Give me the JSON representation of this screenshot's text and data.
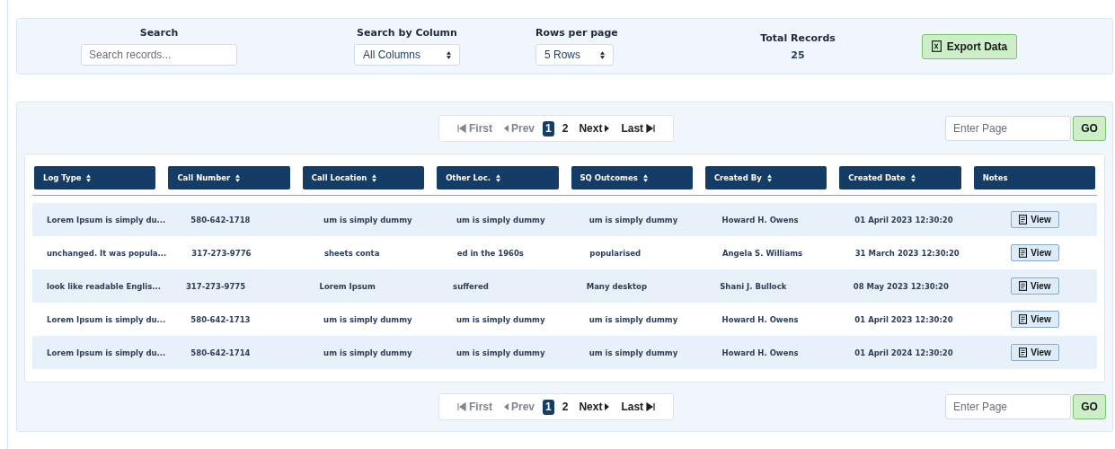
{
  "filters": {
    "search": {
      "label": "Search",
      "placeholder": "Search records..."
    },
    "column_select": {
      "label": "Search by Column",
      "value": "All Columns"
    },
    "rows_select": {
      "label": "Rows per page",
      "value": "5 Rows"
    },
    "total": {
      "label": "Total Records",
      "value": "25"
    },
    "export_button": "Export Data"
  },
  "pagination_top": {
    "first": "First",
    "prev": "Prev",
    "pages": [
      {
        "label": "1",
        "selected": true
      },
      {
        "label": "2",
        "selected": false
      }
    ],
    "next": "Next",
    "last": "Last",
    "page_input": {
      "placeholder": "Enter Page"
    },
    "go_button": "GO"
  },
  "table": {
    "columns": [
      {
        "label": "Log Type",
        "sortable": true
      },
      {
        "label": "Call Number",
        "sortable": true
      },
      {
        "label": "Call Location",
        "sortable": true
      },
      {
        "label": "Other Loc.",
        "sortable": true
      },
      {
        "label": "SQ Outcomes",
        "sortable": true
      },
      {
        "label": "Created By",
        "sortable": true
      },
      {
        "label": "Created Date",
        "sortable": true
      },
      {
        "label": "Notes",
        "sortable": false
      }
    ],
    "rows": [
      {
        "cells": [
          "Lorem Ipsum is simply du...",
          "580-642-1718",
          "um is simply dummy",
          "um is simply dummy",
          "um is simply dummy",
          "Howard H. Owens",
          "01 April 2023 12:30:20"
        ],
        "action": "View"
      },
      {
        "cells": [
          "unchanged. It was popula...",
          "317-273-9776",
          "sheets conta",
          "ed in the 1960s",
          "popularised",
          "Angela S. Williams",
          "31 March 2023 12:30:20"
        ],
        "action": "View"
      },
      {
        "cells": [
          "look like readable Englis...",
          "317-273-9775",
          "Lorem Ipsum",
          "suffered",
          "Many desktop",
          "Shani J. Bullock",
          "08 May 2023 12:30:20"
        ],
        "action": "View"
      },
      {
        "cells": [
          "Lorem Ipsum is simply du...",
          "580-642-1713",
          "um is simply dummy",
          "um is simply dummy",
          "um is simply dummy",
          "Howard H. Owens",
          "01 April 2023 12:30:20"
        ],
        "action": "View"
      },
      {
        "cells": [
          "Lorem Ipsum is simply du...",
          "580-642-1714",
          "um is simply dummy",
          "um is simply dummy",
          "um is simply dummy",
          "Howard H. Owens",
          "01 April 2024 12:30:20"
        ],
        "action": "View"
      }
    ]
  },
  "pagination_bottom": {
    "first": "First",
    "prev": "Prev",
    "pages": [
      {
        "label": "1",
        "selected": true
      },
      {
        "label": "2",
        "selected": false
      }
    ],
    "next": "Next",
    "last": "Last",
    "page_input": {
      "placeholder": "Enter Page"
    },
    "go_button": "GO"
  }
}
